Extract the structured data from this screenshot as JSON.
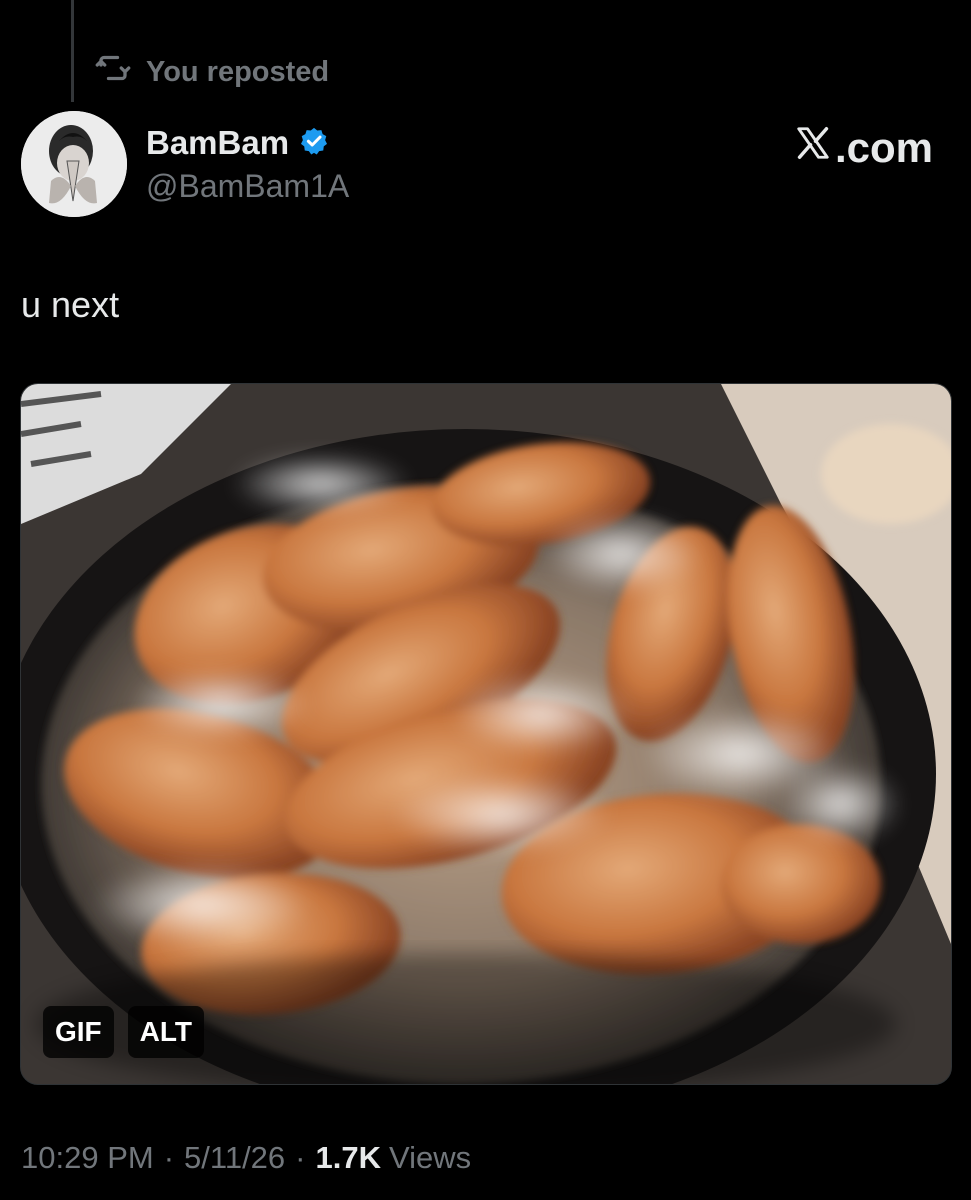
{
  "repost": {
    "label": "You reposted",
    "icon": "repost-icon"
  },
  "author": {
    "name": "BamBam",
    "handle": "@BamBam1A",
    "verified": true,
    "verified_color": "#1d9bf0",
    "avatar": "avatar-photo"
  },
  "brand": {
    "logo_text": ".com",
    "logo_icon": "x-logo-icon"
  },
  "tweet": {
    "text": "u next"
  },
  "media": {
    "description_icon": "fried-chicken-gif",
    "badges": [
      "GIF",
      "ALT"
    ]
  },
  "meta": {
    "time": "10:29 PM",
    "date": "5/11/26",
    "views_count": "1.7K",
    "views_label": "Views",
    "separator": "·"
  },
  "colors": {
    "background": "#000000",
    "text_primary": "#e7e9ea",
    "text_secondary": "#71767b"
  }
}
